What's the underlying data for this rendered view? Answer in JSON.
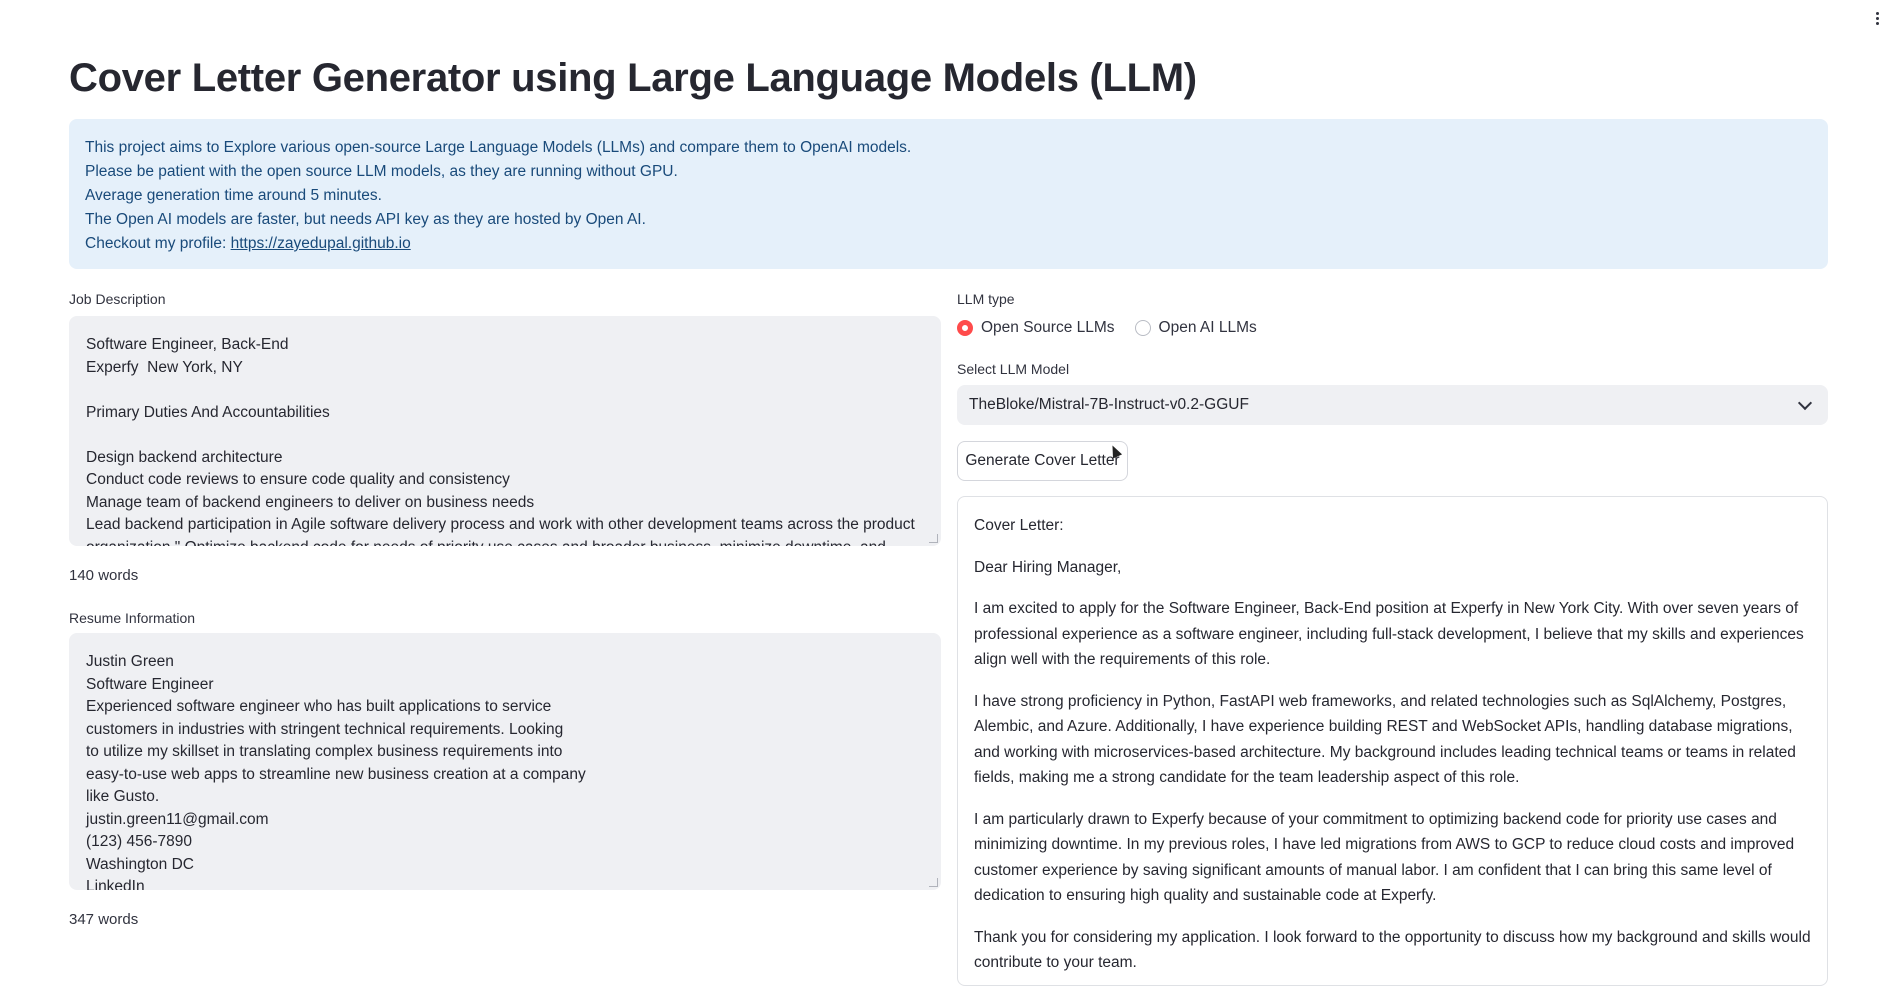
{
  "header": {
    "title": "Cover Letter Generator using Large Language Models (LLM)"
  },
  "info": {
    "lines": [
      "This project aims to Explore various open-source Large Language Models (LLMs) and compare them to OpenAI models.",
      "Please be patient with the open source LLM models, as they are running without GPU.",
      "Average generation time around 5 minutes.",
      "The Open AI models are faster, but needs API key as they are hosted by Open AI."
    ],
    "profile_prefix": "Checkout my profile: ",
    "profile_link": "https://zayedupal.github.io"
  },
  "job_description": {
    "label": "Job Description",
    "lines": [
      "Software Engineer, Back-End",
      "Experfy  New York, NY",
      "",
      "Primary Duties And Accountabilities",
      "",
      "Design backend architecture",
      "Conduct code reviews to ensure code quality and consistency",
      "Manage team of backend engineers to deliver on business needs",
      "Lead backend participation in Agile software delivery process and work with other development teams across the product",
      "organization \" Optimize backend code for needs of priority use cases and broader business, minimize downtime, and"
    ],
    "word_count": "140 words"
  },
  "resume": {
    "label": "Resume Information",
    "lines": [
      "Justin Green",
      "Software Engineer",
      "Experienced software engineer who has built applications to service",
      "customers in industries with stringent technical requirements. Looking",
      "to utilize my skillset in translating complex business requirements into",
      "easy-to-use web apps to streamline new business creation at a company",
      "like Gusto.",
      "justin.green11@gmail.com",
      "(123) 456-7890",
      "Washington DC",
      "LinkedIn"
    ],
    "word_count": "347 words"
  },
  "llm_type": {
    "label": "LLM type",
    "options": [
      "Open Source LLMs",
      "Open AI LLMs"
    ],
    "selected": "Open Source LLMs"
  },
  "model_select": {
    "label": "Select LLM Model",
    "value": "TheBloke/Mistral-7B-Instruct-v0.2-GGUF"
  },
  "generate_button": "Generate Cover Letter",
  "output": {
    "paragraphs": [
      "Cover Letter:",
      "Dear Hiring Manager,",
      "I am excited to apply for the Software Engineer, Back-End position at Experfy in New York City. With over seven years of professional experience as a software engineer, including full-stack development, I believe that my skills and experiences align well with the requirements of this role.",
      "I have strong proficiency in Python, FastAPI web frameworks, and related technologies such as SqlAlchemy, Postgres, Alembic, and Azure. Additionally, I have experience building REST and WebSocket APIs, handling database migrations, and working with microservices-based architecture. My background includes leading technical teams or teams in related fields, making me a strong candidate for the team leadership aspect of this role.",
      "I am particularly drawn to Experfy because of your commitment to optimizing backend code for priority use cases and minimizing downtime. In my previous roles, I have led migrations from AWS to GCP to reduce cloud costs and improved customer experience by saving significant amounts of manual labor. I am confident that I can bring this same level of dedication to ensuring high quality and sustainable code at Experfy.",
      "Thank you for considering my application. I look forward to the opportunity to discuss how my background and skills would contribute to your team."
    ]
  },
  "colors": {
    "accent": "#ff4b4b",
    "info_bg": "#e5f0fa",
    "info_text": "#194a7a",
    "input_bg": "#eff0f3"
  }
}
